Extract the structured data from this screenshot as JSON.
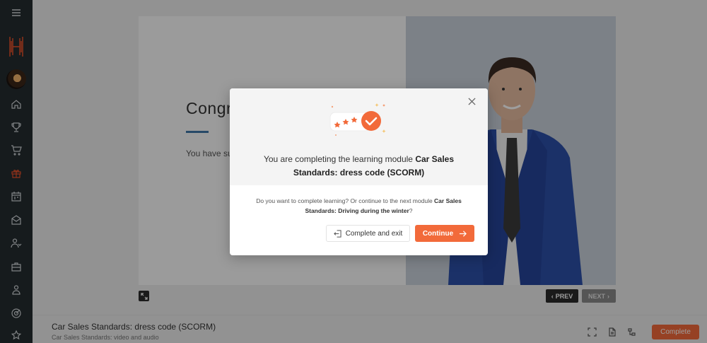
{
  "sidebar": {
    "icons": [
      "menu-icon",
      "home-icon",
      "trophy-icon",
      "cart-icon",
      "gift-icon",
      "calendar-icon",
      "inbox-icon",
      "users-icon",
      "briefcase-icon",
      "user-icon",
      "target-icon",
      "star-icon"
    ],
    "active_icon": "gift-icon",
    "accent_color": "#e8512a"
  },
  "slide": {
    "heading_partial": "Congr",
    "text_partial": "You have suc",
    "prev_label": "PREV",
    "next_label": "NEXT"
  },
  "bottom_bar": {
    "course_title": "Car Sales Standards: dress code (SCORM)",
    "course_subtitle": "Car Sales Standards: video and audio",
    "complete_label": "Complete"
  },
  "modal": {
    "heading_prefix": "You are completing the learning module ",
    "heading_module": "Car Sales Standards: dress code (SCORM)",
    "question_prefix": "Do you want to complete learning? Or continue to the next module ",
    "question_module": "Car Sales Standards: Driving during the winter",
    "question_suffix": "?",
    "exit_label": "Complete and exit",
    "continue_label": "Continue"
  },
  "colors": {
    "primary_orange": "#f26a3a",
    "sidebar_bg": "#252c30"
  }
}
